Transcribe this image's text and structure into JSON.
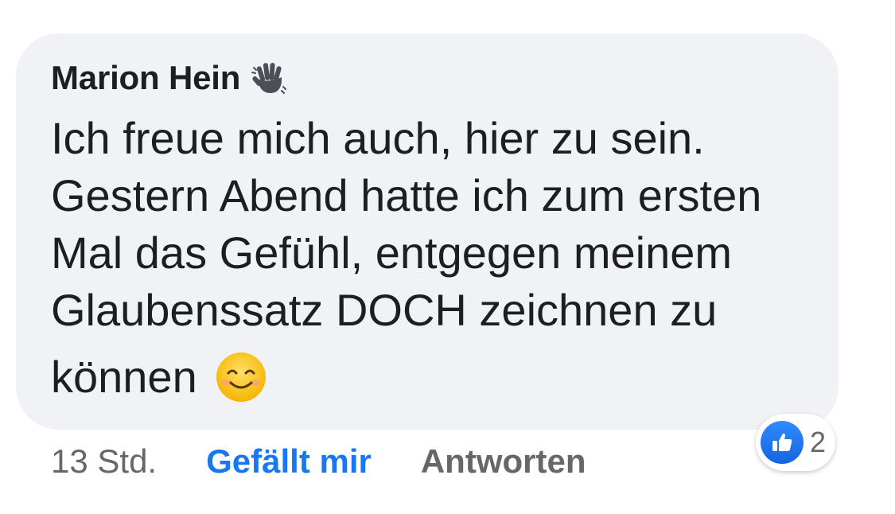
{
  "comment": {
    "author": "Marion Hein",
    "author_icon": "waving-hand-icon",
    "lines": [
      "Ich freue mich auch, hier zu sein.",
      "Gestern Abend hatte ich zum ersten",
      "Mal das Gefühl, entgegen meinem",
      "Glaubenssatz DOCH zeichnen zu",
      "können"
    ],
    "trailing_emoji": "smiling-face-icon"
  },
  "meta": {
    "timestamp": "13 Std.",
    "like_label": "Gefällt mir",
    "reply_label": "Antworten"
  },
  "reactions": {
    "icon": "thumbs-up-icon",
    "count": "2"
  },
  "colors": {
    "bubble": "#f0f2f5",
    "text": "#1c1e21",
    "secondary": "#65676b",
    "accent": "#1877f2"
  }
}
